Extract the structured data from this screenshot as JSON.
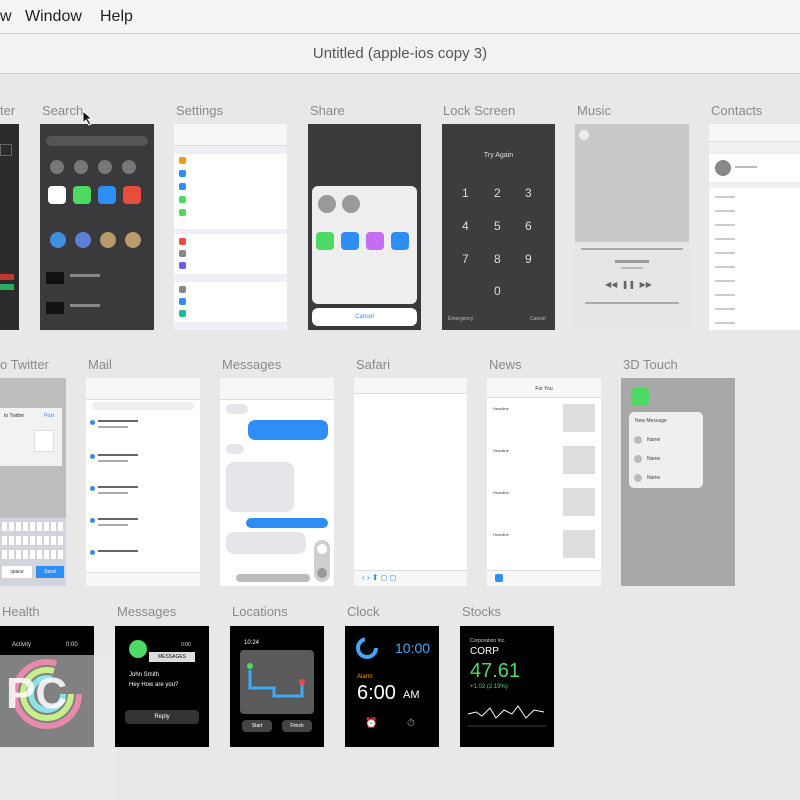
{
  "menubar": {
    "items": [
      "w",
      "Window",
      "Help"
    ]
  },
  "window": {
    "title": "Untitled (apple-ios copy 3)"
  },
  "artboards": {
    "row1": [
      "ter",
      "Search",
      "Settings",
      "Share",
      "Lock Screen",
      "Music",
      "Contacts"
    ],
    "row2": [
      "o Twitter",
      "Mail",
      "Messages",
      "Safari",
      "News",
      "3D Touch"
    ],
    "row3": [
      "Health",
      "Messages",
      "Locations",
      "Clock",
      "Stocks"
    ]
  },
  "lockscreen": {
    "header": "Try Again",
    "digits": [
      "1",
      "2",
      "3",
      "4",
      "5",
      "6",
      "7",
      "8",
      "9",
      "0"
    ],
    "emergency": "Emergency",
    "cancel": "Cancel"
  },
  "share": {
    "cancel": "Cancel"
  },
  "twitter": {
    "title": "to Twitter",
    "post": "Post",
    "cancel": "Cancel",
    "space": "space",
    "send": "Send"
  },
  "news": {
    "title": "For You",
    "item_label": "Headline"
  },
  "touch3d": {
    "items": [
      "New Message",
      "Name",
      "Name",
      "Name"
    ]
  },
  "watch": {
    "health": {
      "title": "Activity",
      "time": "0:00"
    },
    "messages": {
      "app": "MESSAGES",
      "time": "0:00",
      "sender": "John Smith",
      "body": "Hey How are you?",
      "reply": "Reply"
    },
    "locations": {
      "time": "10:24",
      "left_btn": "Start",
      "right_btn": "Finish"
    },
    "clock": {
      "time": "10:00",
      "alarm_label": "Alarm",
      "alarm_time": "6:00",
      "alarm_ampm": "AM"
    },
    "stocks": {
      "company": "Corporation Inc.",
      "ticker": "CORP",
      "price": "47.61",
      "change": "+1.02 (2.19%)"
    }
  },
  "colors": {
    "ios_blue": "#2f8ef5",
    "ios_green": "#4cd964",
    "watch_bg": "#000000",
    "dark_screen": "#3a3a3c"
  },
  "watermark": {
    "text": "PC"
  }
}
